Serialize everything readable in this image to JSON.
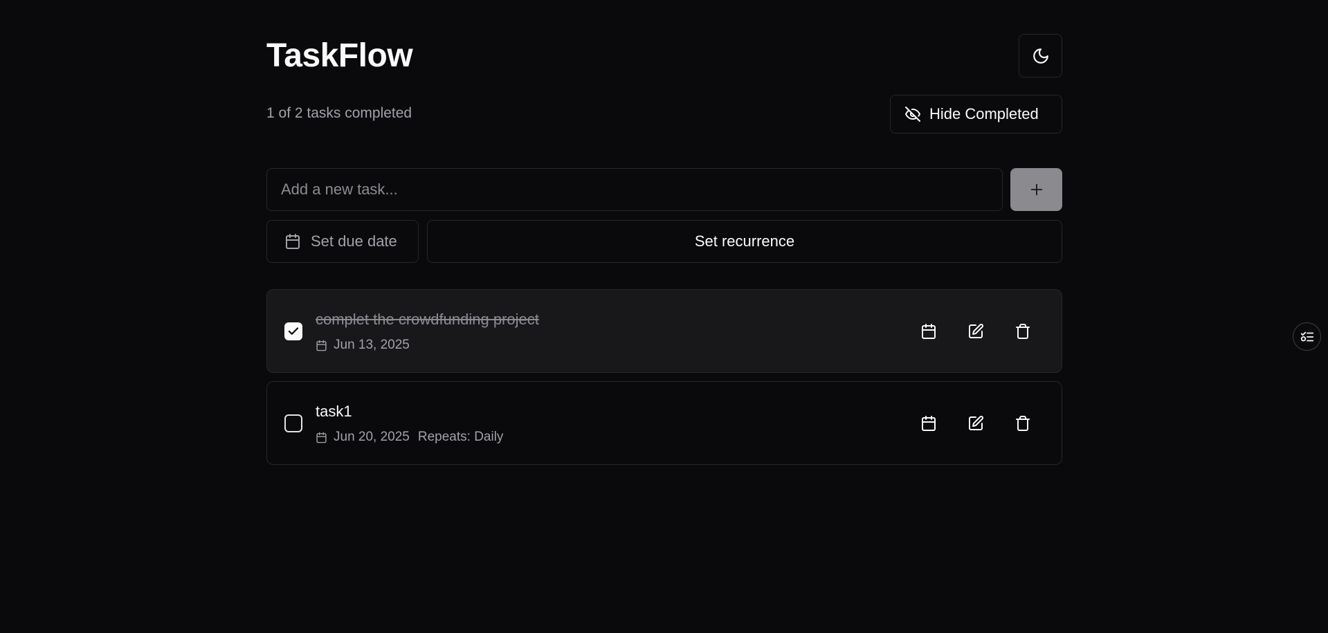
{
  "app": {
    "title": "TaskFlow",
    "theme_toggle_icon": "moon-icon"
  },
  "status": {
    "summary": "1 of 2 tasks completed",
    "hide_completed_label": "Hide Completed",
    "hide_completed_icon": "eye-off-icon"
  },
  "add_task": {
    "placeholder": "Add a new task...",
    "value": "",
    "add_icon": "plus-icon"
  },
  "options": {
    "due_date_label": "Set due date",
    "due_date_icon": "calendar-icon",
    "recurrence_label": "Set recurrence"
  },
  "tasks": [
    {
      "title": "complet the crowdfunding project",
      "completed": true,
      "due_date": "Jun 13, 2025",
      "repeats": ""
    },
    {
      "title": "task1",
      "completed": false,
      "due_date": "Jun 20, 2025",
      "repeats": "Repeats: Daily"
    }
  ],
  "task_actions": [
    "calendar-icon",
    "edit-icon",
    "trash-icon"
  ],
  "floating": {
    "icon": "task-list-icon"
  },
  "colors": {
    "background": "#0a0a0c",
    "surface_done": "#18181b",
    "border": "#27272a",
    "text": "#fafafa",
    "muted": "#a1a1aa",
    "add_button": "#8a8a8f"
  }
}
